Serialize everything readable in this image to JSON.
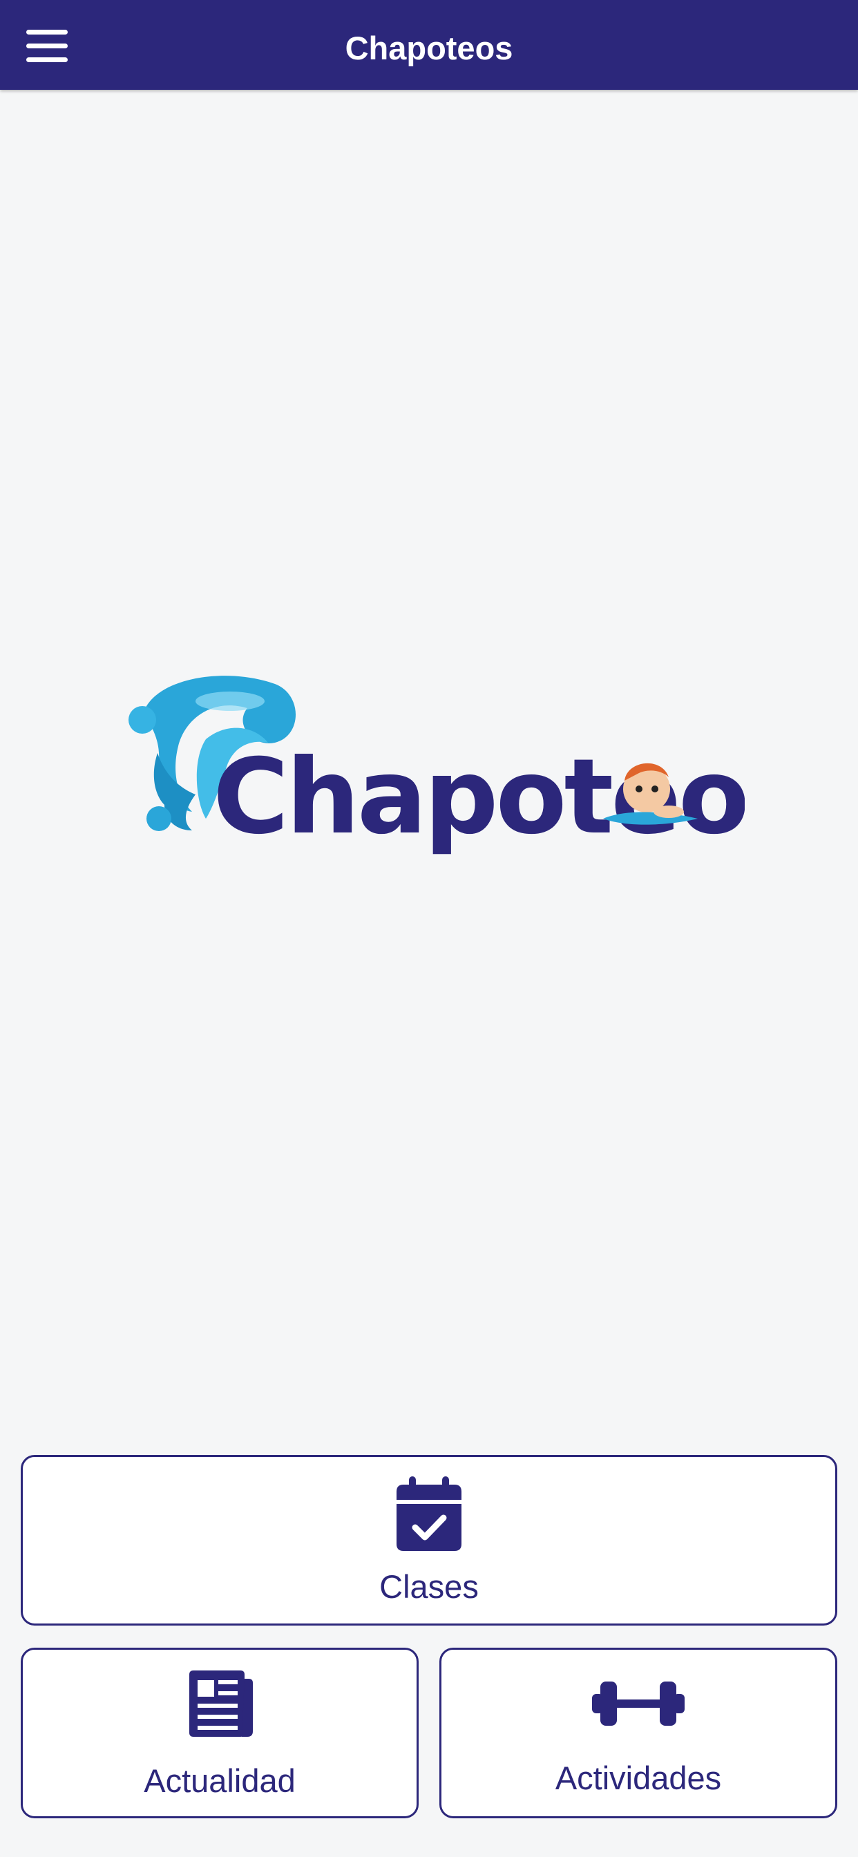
{
  "app": {
    "title": "Chapoteos",
    "accent_color": "#2c277b",
    "background_color": "#f5f6f7"
  },
  "header": {
    "menu_icon": "hamburger-menu-icon"
  },
  "logo": {
    "text": "Chapoteos",
    "icon": "water-splash-baby-swimmer-logo"
  },
  "cards": [
    {
      "label": "Clases",
      "icon": "calendar-check-icon"
    },
    {
      "label": "Actualidad",
      "icon": "newspaper-icon"
    },
    {
      "label": "Actividades",
      "icon": "dumbbell-icon"
    }
  ]
}
